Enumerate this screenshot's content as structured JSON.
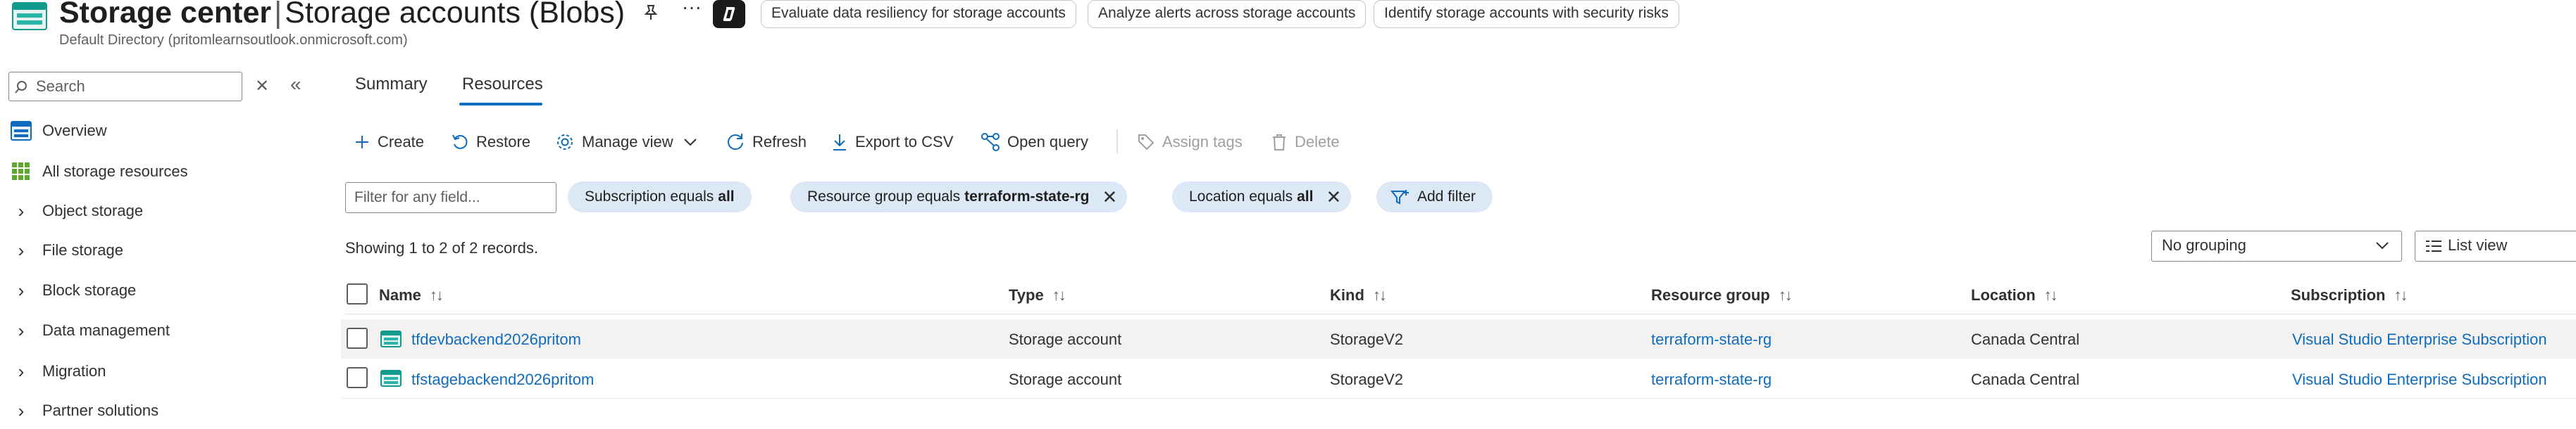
{
  "header": {
    "title": "Storage center",
    "subtitle": "Storage accounts (Blobs)",
    "directory": "Default Directory (pritomlearnsoutlook.onmicrosoft.com)",
    "more": "···",
    "prompts": [
      "Evaluate data resiliency for storage accounts",
      "Analyze alerts across storage accounts",
      "Identify storage accounts with security risks"
    ]
  },
  "sidebar": {
    "search_placeholder": "Search",
    "clear": "✕",
    "collapse": "«",
    "items": [
      {
        "label": "Overview",
        "icon": "storage-overview-icon"
      },
      {
        "label": "All storage resources",
        "icon": "grid-icon"
      },
      {
        "label": "Object storage",
        "icon": "chevron-right-icon"
      },
      {
        "label": "File storage",
        "icon": "chevron-right-icon"
      },
      {
        "label": "Block storage",
        "icon": "chevron-right-icon"
      },
      {
        "label": "Data management",
        "icon": "chevron-right-icon"
      },
      {
        "label": "Migration",
        "icon": "chevron-right-icon"
      },
      {
        "label": "Partner solutions",
        "icon": "chevron-right-icon"
      }
    ]
  },
  "tabs": [
    {
      "label": "Summary",
      "selected": false
    },
    {
      "label": "Resources",
      "selected": true
    }
  ],
  "toolbar": {
    "create": "Create",
    "restore": "Restore",
    "manage_view": "Manage view",
    "refresh": "Refresh",
    "export": "Export to CSV",
    "open_query": "Open query",
    "assign_tags": "Assign tags",
    "delete": "Delete"
  },
  "filters": {
    "placeholder": "Filter for any field...",
    "subscription": {
      "prefix": "Subscription equals",
      "value": "all"
    },
    "resource_group": {
      "prefix": "Resource group equals",
      "value": "terraform-state-rg"
    },
    "location": {
      "prefix": "Location equals",
      "value": "all"
    },
    "add_filter": "Add filter"
  },
  "records_text": "Showing 1 to 2 of 2 records.",
  "grouping": "No grouping",
  "view": "List view",
  "table": {
    "columns": [
      "Name",
      "Type",
      "Kind",
      "Resource group",
      "Location",
      "Subscription"
    ],
    "sort_glyph": "↑↓",
    "rows": [
      {
        "name": "tfdevbackend2026pritom",
        "type": "Storage account",
        "kind": "StorageV2",
        "resource_group": "terraform-state-rg",
        "location": "Canada Central",
        "subscription": "Visual Studio Enterprise Subscription"
      },
      {
        "name": "tfstagebackend2026pritom",
        "type": "Storage account",
        "kind": "StorageV2",
        "resource_group": "terraform-state-rg",
        "location": "Canada Central",
        "subscription": "Visual Studio Enterprise Subscription"
      }
    ]
  },
  "colors": {
    "accent": "#0f6cbd",
    "pill_bg": "#dde8f6",
    "row_hover": "#f3f2f1",
    "storage_icon": "#0f9b8e"
  }
}
